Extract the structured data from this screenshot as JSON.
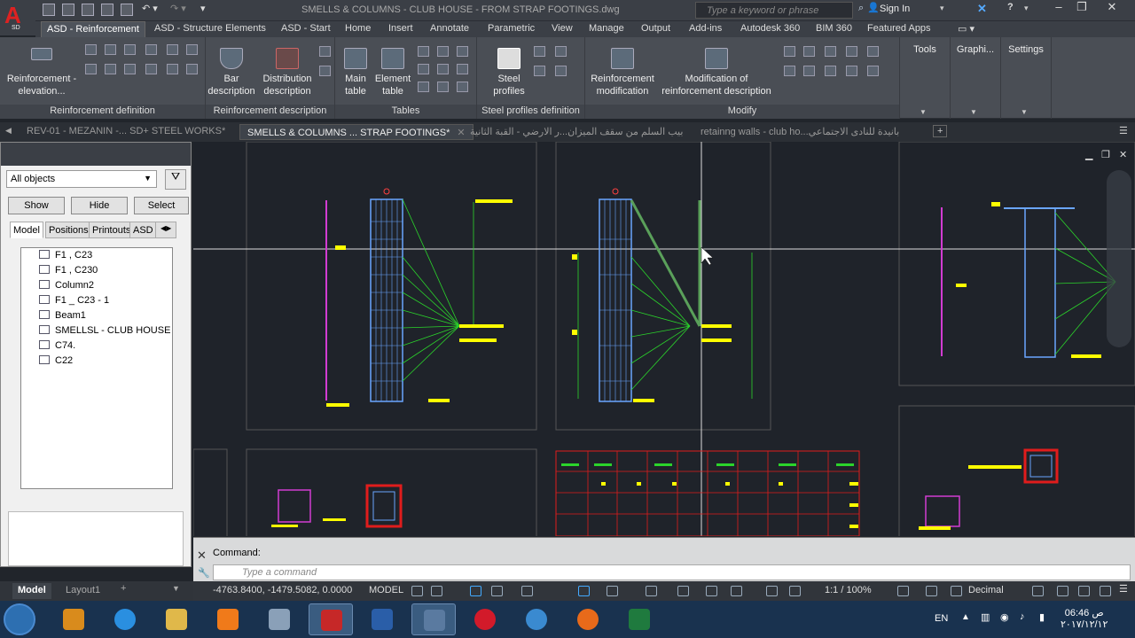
{
  "app": {
    "logo_text": "A",
    "logo_sub": "SD",
    "window_title": "SMELLS & COLUMNS - CLUB HOUSE - FROM STRAP FOOTINGS.dwg"
  },
  "search": {
    "placeholder": "Type a keyword or phrase"
  },
  "account": {
    "sign_in": "Sign In"
  },
  "ribbon_tabs": [
    "ASD - Reinforcement",
    "ASD - Structure Elements",
    "ASD - Start",
    "Home",
    "Insert",
    "Annotate",
    "Parametric",
    "View",
    "Manage",
    "Output",
    "Add-ins",
    "Autodesk 360",
    "BIM 360",
    "Featured Apps"
  ],
  "panels": {
    "reinf_def": {
      "title": "Reinforcement definition",
      "big1": "Reinforcement -",
      "big1b": "elevation..."
    },
    "reinf_desc": {
      "title": "Reinforcement description",
      "bar1": "Bar",
      "bar2": "description",
      "dist1": "Distribution",
      "dist2": "description"
    },
    "tables": {
      "title": "Tables",
      "main1": "Main",
      "main2": "table",
      "elem1": "Element",
      "elem2": "table"
    },
    "steel": {
      "title": "Steel profiles definition",
      "s1": "Steel",
      "s2": "profiles"
    },
    "modify": {
      "title": "Modify",
      "m1": "Reinforcement",
      "m2": "modification",
      "d1": "Modification of",
      "d2": "reinforcement description"
    },
    "tools": {
      "title": "Tools"
    },
    "graphi": {
      "title": "Graphi..."
    },
    "settings": {
      "title": "Settings"
    }
  },
  "doc_tabs": [
    {
      "label": "REV-01 - MEZANIN -... SD+ STEEL WORKS*"
    },
    {
      "label": "SMELLS & COLUMNS ... STRAP FOOTINGS*"
    },
    {
      "label": "بيب السلم من سقف الميزان...ر الارضي - القبة الثانية"
    },
    {
      "label": "retainng walls - club ho...بانيدة للنادى الاجتماعي"
    }
  ],
  "left_panel": {
    "filter": "All objects",
    "buttons": [
      "Show",
      "Hide",
      "Select"
    ],
    "tabs": [
      "Model",
      "Positions",
      "Printouts",
      "ASD"
    ],
    "tree": [
      "F1 , C23",
      "F1 , C230",
      "Column2",
      "F1 _ C23 - 1",
      "Beam1",
      "SMELLSL - CLUB HOUSE",
      "C74.",
      "C22"
    ]
  },
  "command": {
    "label": "Command:",
    "placeholder": "Type a command"
  },
  "layout_tabs": [
    "Model",
    "Layout1"
  ],
  "status": {
    "coords": "-4763.8400, -1479.5082, 0.0000",
    "model": "MODEL",
    "scale": "1:1 / 100%",
    "units": "Decimal"
  },
  "taskbar": {
    "lang": "EN",
    "time": "06:46 ص",
    "date": "۲۰۱۷/۱۲/۱۲"
  },
  "colors": {
    "accent": "#cc1f1f",
    "canvas": "#1f232a",
    "rebar_blue": "#6aa6ff",
    "rebar_green": "#2bd42b",
    "dim_yellow": "#ffff00",
    "magenta": "#d23cd2",
    "table_red": "#e01c1c"
  }
}
